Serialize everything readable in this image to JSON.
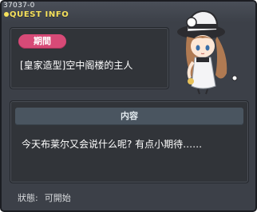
{
  "window": {
    "quest_id": "37037-0",
    "title": "QUEST INFO"
  },
  "period": {
    "label": "期間",
    "quest_name": "[皇家造型]空中阁楼的主人"
  },
  "content": {
    "label": "内容",
    "text": "今天布莱尔又会说什么呢? 有点小期待……"
  },
  "status": {
    "label": "狀態:",
    "value": "可開始"
  },
  "npc": {
    "icon": "npc-girl-portrait"
  },
  "colors": {
    "title_accent": "#f6e15c",
    "period_badge": "#d74a77",
    "window_bg": "#3c4048",
    "panel_bg": "#313439",
    "content_header_bg": "#4a5560"
  }
}
